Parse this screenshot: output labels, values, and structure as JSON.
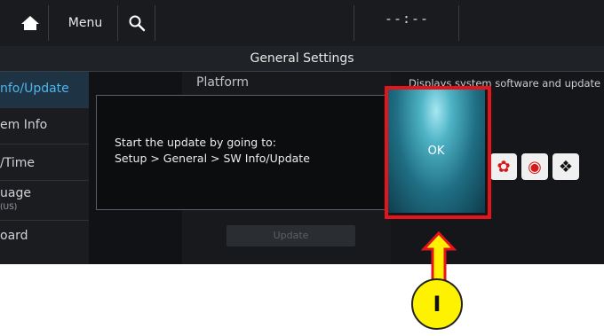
{
  "topbar": {
    "home_icon": "home-icon",
    "menu_label": "Menu",
    "search_icon": "search-icon",
    "clock": "--:--"
  },
  "header": {
    "title": "General Settings"
  },
  "sidebar": {
    "items": [
      {
        "label": "nfo/Update",
        "active": true
      },
      {
        "label": "em Info"
      },
      {
        "label": "/Time"
      },
      {
        "label": "uage",
        "sub": "(US)"
      },
      {
        "label": "oard"
      }
    ]
  },
  "main": {
    "platform_label": "Platform",
    "update_button": "Update"
  },
  "right_panel": {
    "description": "Displays system software and update information.",
    "logo_icons": [
      "red-rose-logo-icon",
      "red-swirl-logo-icon",
      "black-eagle-logo-icon"
    ]
  },
  "dialog": {
    "line1": "Start the update by going to:",
    "line2": "Setup > General > SW Info/Update",
    "ok_label": "OK"
  },
  "annotation": {
    "marker_label": "I",
    "highlight_color": "#e5131a",
    "marker_color": "#fff200"
  }
}
